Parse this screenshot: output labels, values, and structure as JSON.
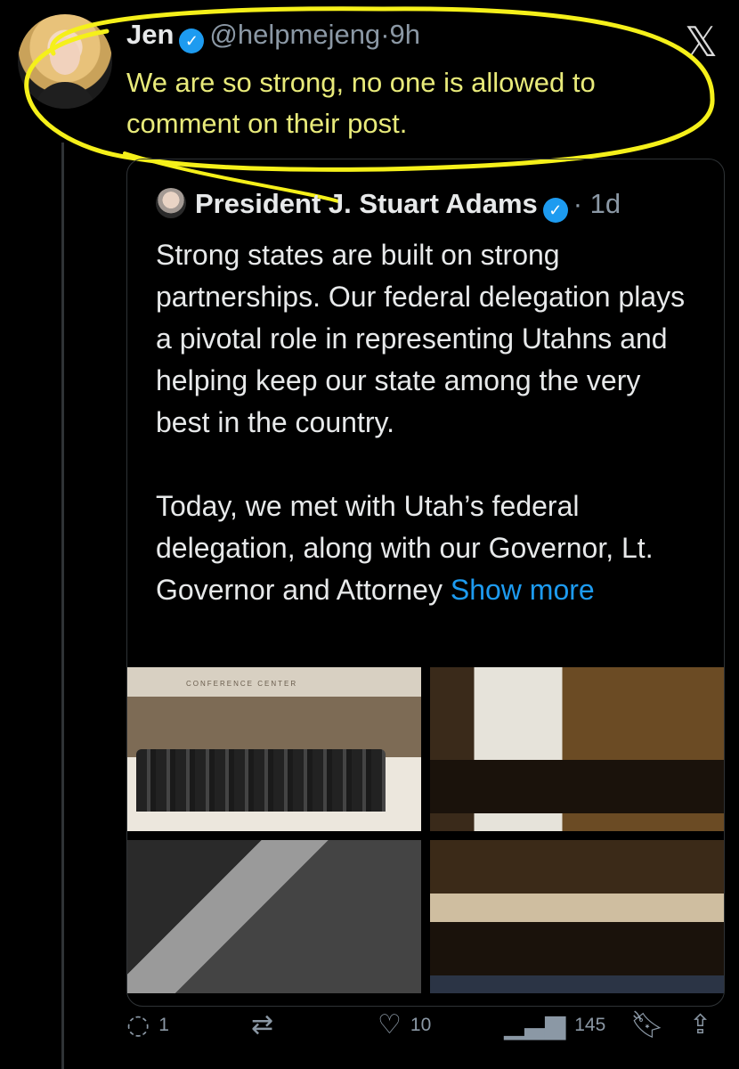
{
  "post": {
    "author_name": "Jen",
    "handle": "@helpmejeng",
    "time": "·9h",
    "text": "We are so strong, no one is allowed to comment on their post."
  },
  "quoted": {
    "author_name": "President J. Stuart Adams",
    "time": "· 1d",
    "paragraph1": "Strong states are built on strong partnerships. Our federal delegation plays a pivotal role in representing Utahns and helping keep our state among the very best in the country.",
    "paragraph2": "Today, we met with Utah’s federal delegation, along with our Governor, Lt. Governor and Attorney",
    "show_more": "Show more",
    "image1_sign": "CONFERENCE CENTER"
  },
  "actions": {
    "replies": "1",
    "likes": "10",
    "views": "145"
  },
  "icons": {
    "verified": "verified-badge-icon",
    "x_logo": "x-logo-icon",
    "reply": "reply-icon",
    "repost": "repost-icon",
    "like": "heart-icon",
    "views": "views-icon",
    "bookmark": "bookmark-icon",
    "share": "share-icon"
  },
  "colors": {
    "background": "#000000",
    "accent": "#1d9bf0",
    "highlight": "#f5f01a",
    "muted": "#8b98a5"
  }
}
